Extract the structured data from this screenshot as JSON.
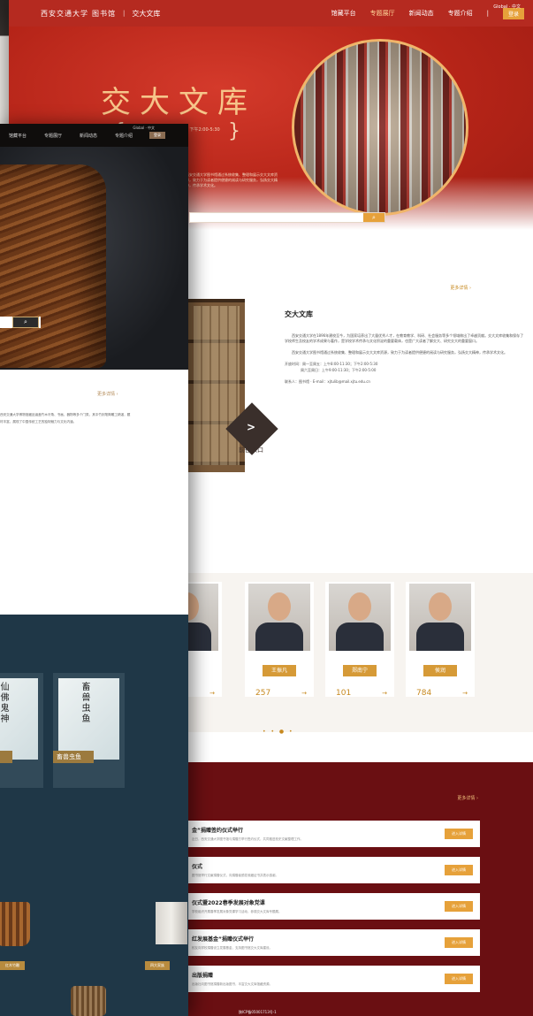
{
  "back": {
    "logo_cn": "西安交通大学",
    "logo_lib": "图书馆",
    "site_title": "交大文库",
    "nav": [
      "馆藏平台",
      "专题展厅",
      "新闻动态",
      "专题介绍"
    ],
    "lang": "Global · 中文",
    "login": "登录",
    "hero_title": "交大文库",
    "search_button": "⌕",
    "more": "更多详情 ›",
    "intro_title": "交大文库",
    "intro_p1": "西安交通大学在1896年建校至今，为国家培养出了大量优秀人才，在教育教学、科研、社会服务等多个领域做出了卓越贡献。交大文库收集和保存了学校师生及校友的学术成果与著作，是学校学术传承与文化积淀的重要载体，也是广大读者了解交大、研究交大的重要窗口。",
    "intro_p2": "西安交通大学图书馆通过系统收集、整理和展示交大文库资源，致力于为读者提供便捷的阅读与研究服务，弘扬交大精神，传承学术文化。",
    "open_label": "开放时间：",
    "open_1": "周一至周五：上午8:00-11:30；下午2:00-5:30",
    "open_2": "周六至周日：上午9:00-11:30；下午2:00-5:00",
    "contact": "联系人：图书馆 · E-mail：xjtulib@mail.xjtu.edu.cn",
    "enter_label": "前往入口",
    "experts": [
      {
        "name": "",
        "num": ""
      },
      {
        "name": "王振凡",
        "num": "257"
      },
      {
        "name": "郑南宁",
        "num": "101"
      },
      {
        "name": "侯润",
        "num": "784"
      }
    ],
    "dots": "• • ● •",
    "news_more": "更多详情 ›",
    "news": [
      {
        "title": "金”捐赠签约仪式举行",
        "desc": "近日，西安交通大学图书馆与捐赠方举行签约仪式，共同推进校史文献整理工作。"
      },
      {
        "title": "仪式",
        "desc": "图书馆举行文献捐赠仪式，向捐赠者颁发收藏证书并表示感谢。"
      },
      {
        "title": "仪式暨2022春季发展对象党课",
        "desc": "学校组织开展春季发展对象党课学习活动，参观交大文库专题展。"
      },
      {
        "title": "红发展基金”捐赠仪式举行",
        "desc": "校友向学校捐赠设立发展基金，支持图书馆交大文库建设。"
      },
      {
        "title": "出版捐赠",
        "desc": "出版社向图书馆捐赠新出版图书，丰富交大文库馆藏资源。"
      }
    ],
    "news_btn": "进入详情",
    "footer": "陕ICP备05001713号-1"
  },
  "front": {
    "nav": [
      "馆藏平台",
      "专题展厅",
      "新闻动态",
      "专题介绍"
    ],
    "lang": "Global · 中文",
    "login": "登录",
    "search_button": "⌕",
    "more": "更多详情 ›",
    "desc": "西安交通大学博物馆藏品涵盖竹木牙角、书画、器物等多个门类，其中竹刻笔筒雕工精湛，题材丰富，展现了中国传统工艺的独特魅力与文化内涵。",
    "cards": [
      {
        "vertical": "仙佛鬼神",
        "label": "鬼神"
      },
      {
        "vertical": "畜兽虫鱼",
        "label": "畜兽虫鱼"
      }
    ],
    "tags": [
      "红木竹雕",
      "四大家族"
    ]
  }
}
